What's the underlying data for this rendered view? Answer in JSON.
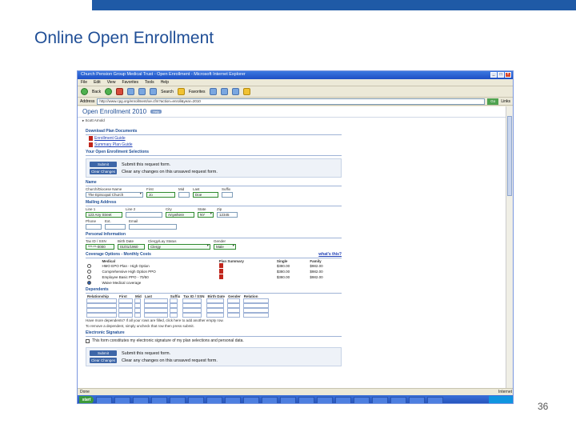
{
  "slide": {
    "title": "Online Open Enrollment",
    "page_number": "36"
  },
  "browser": {
    "window_title": "Church Pension Group Medical Trust - Open Enrollment - Microsoft Internet Explorer",
    "menu": [
      "File",
      "Edit",
      "View",
      "Favorites",
      "Tools",
      "Help"
    ],
    "toolbar": {
      "back": "Back",
      "search": "Search",
      "favorites": "Favorites"
    },
    "address_label": "Address",
    "url": "http://www.cpg.org/enrollment/oe.cfm?action=enroll&year=2010",
    "go_label": "Go",
    "links_label": "Links",
    "status_left": "Done",
    "status_right": "Internet",
    "start_label": "start"
  },
  "app": {
    "title": "Open Enrollment 2010",
    "badge": "Help",
    "user": "▸ Scott Arnold",
    "sections": {
      "download": "Download Plan Documents",
      "selections": "Your Open Enrollment Selections",
      "name": "Name",
      "mailing": "Mailing Address",
      "personal": "Personal Information",
      "coverage": "Coverage Options - Monthly Costs",
      "coverage_link": "what's this?",
      "dependents": "Dependents",
      "signature": "Electronic Signature"
    },
    "documents": [
      "Enrollment Guide",
      "Summary Plan Guide"
    ],
    "actions": {
      "submit_btn": "Submit",
      "submit_text": "Submit this request form.",
      "clear_btn": "Clear Changes",
      "clear_text": "Clear any changes on this unsaved request form."
    },
    "name_fields": {
      "labels": [
        "Church/Diocese Name",
        "First",
        "Mid",
        "Last",
        "Suffix"
      ],
      "values": [
        "The Episcopal Church",
        "Jo",
        "",
        "Doe",
        ""
      ]
    },
    "address_fields": {
      "labels": [
        "Line 1",
        "Line 2",
        "City",
        "State",
        "Zip"
      ],
      "values": [
        "123 Any Street",
        "",
        "Anywhere",
        "NY",
        "12345"
      ],
      "labels2": [
        "Phone",
        "Ext.",
        "Email"
      ],
      "values2": [
        "",
        "",
        ""
      ]
    },
    "personal_fields": {
      "labels": [
        "Tax ID / SSN",
        "Birth Date",
        "Clergy/Lay Status",
        "Gender"
      ],
      "values": [
        "***-**-0000",
        "01/01/1960",
        "Clergy",
        "Male"
      ]
    },
    "coverage": {
      "headers": [
        "",
        "Medical",
        "Plan Summary",
        "Single",
        "Family"
      ],
      "rows": [
        {
          "plan": "HMO EPO Plan - High Option",
          "single": "$380.00",
          "family": "$982.00",
          "selected": false
        },
        {
          "plan": "Comprehensive High Option PPO",
          "single": "$380.00",
          "family": "$982.00",
          "selected": false
        },
        {
          "plan": "Employee Basic PPO - 70/50",
          "single": "$380.00",
          "family": "$982.00",
          "selected": false
        },
        {
          "plan": "Waive Medical coverage",
          "single": "",
          "family": "",
          "selected": true
        }
      ]
    },
    "dependents": {
      "headers": [
        "Relationship",
        "First",
        "Mid",
        "Last",
        "Suffix",
        "Tax ID / SSN",
        "Birth Date",
        "Gender",
        "Relation"
      ],
      "rows": 4,
      "note": "Have more dependents? If all your rows are filled, click here to add another empty row.",
      "note2": "To remove a dependent, simply uncheck that row then press submit."
    },
    "signature_text": "This form constitutes my electronic signature of my plan selections and personal data."
  }
}
